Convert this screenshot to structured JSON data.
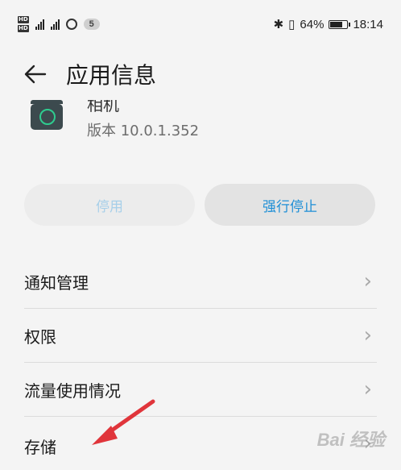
{
  "status_bar": {
    "badge_count": "5",
    "battery": "64%",
    "time": "18:14",
    "battery_level": 0.64
  },
  "header": {
    "title": "应用信息"
  },
  "app": {
    "name": "相机",
    "version": "版本 10.0.1.352",
    "icon": "camera-icon"
  },
  "actions": {
    "disable": "停用",
    "force_stop": "强行停止"
  },
  "menu": {
    "items": [
      {
        "label": "通知管理"
      },
      {
        "label": "权限"
      },
      {
        "label": "流量使用情况"
      },
      {
        "label": "存储"
      }
    ]
  },
  "colors": {
    "accent": "#1f8fd6",
    "arrow": "#e0353b"
  },
  "watermark": "Bai 经验"
}
